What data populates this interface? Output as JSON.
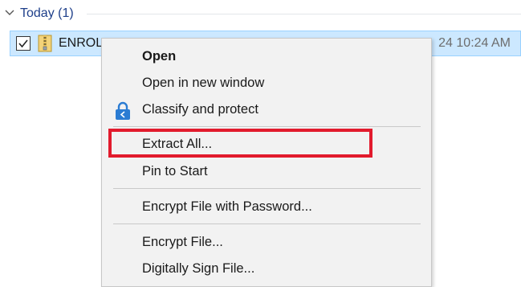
{
  "group": {
    "label": "Today (1)"
  },
  "file": {
    "name": "ENROL",
    "date": "24 10:24 AM",
    "checked": true
  },
  "context_menu": {
    "items": [
      {
        "label": "Open",
        "bold": true,
        "icon": "none"
      },
      {
        "label": "Open in new window",
        "icon": "none"
      },
      {
        "label": "Classify and protect",
        "icon": "lock-icon"
      },
      {
        "label": "Extract All...",
        "icon": "none",
        "highlighted": true
      },
      {
        "label": "Pin to Start",
        "icon": "none"
      },
      {
        "label": "Encrypt File with Password...",
        "icon": "none"
      },
      {
        "label": "Encrypt File...",
        "icon": "none"
      },
      {
        "label": "Digitally Sign File...",
        "icon": "none"
      }
    ]
  },
  "colors": {
    "selection": "#cce8ff",
    "highlight_box": "#e21b2d",
    "group_title": "#1e3f8a",
    "lock_icon": "#2b7cd3"
  }
}
